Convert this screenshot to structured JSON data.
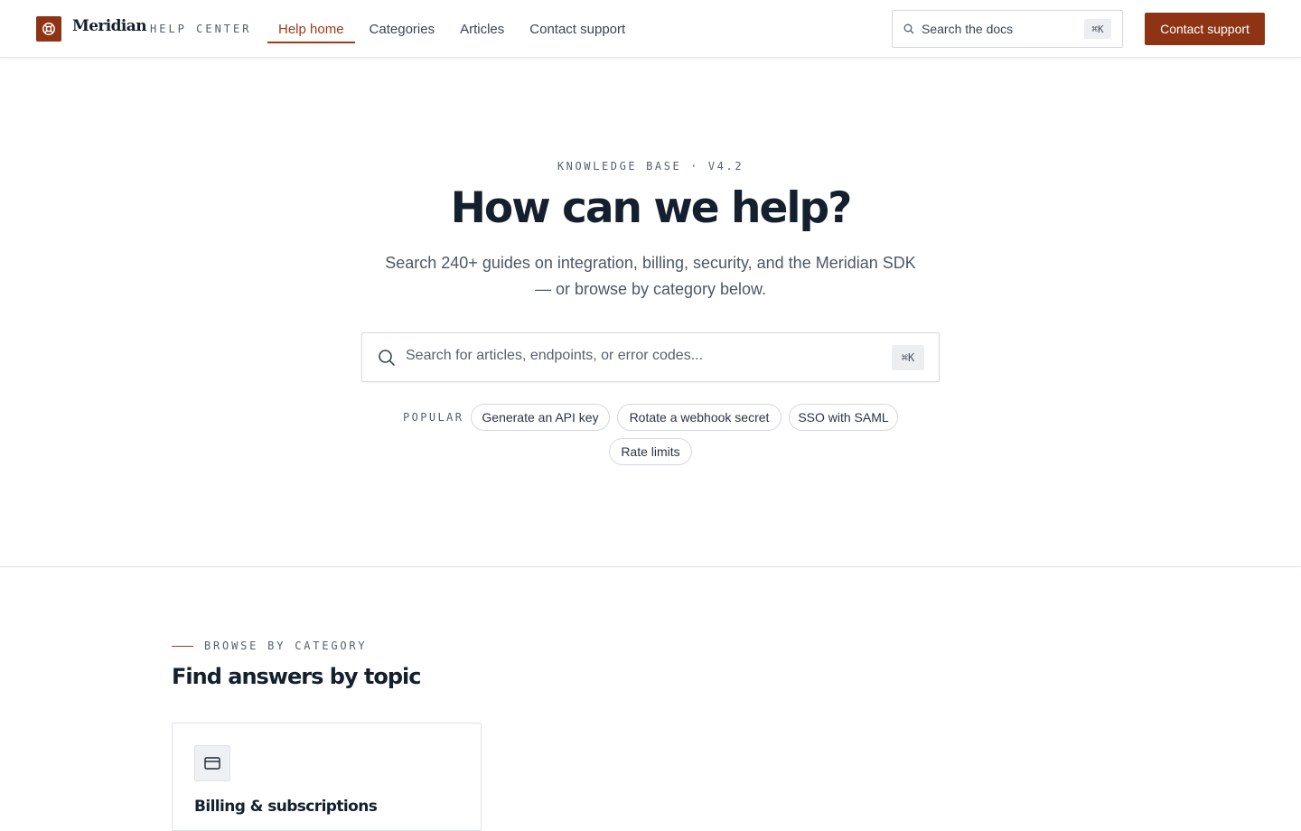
{
  "header": {
    "brand_name": "Meridian",
    "brand_tag": "HELP CENTER",
    "nav": [
      {
        "label": "Help home",
        "active": true
      },
      {
        "label": "Categories"
      },
      {
        "label": "Articles"
      },
      {
        "label": "Contact support"
      }
    ],
    "search_placeholder": "Search the docs",
    "search_shortcut": "⌘K",
    "cta_label": "Contact support"
  },
  "hero": {
    "eyebrow": "KNOWLEDGE BASE · V4.2",
    "title": "How can we help?",
    "subtitle": "Search 240+ guides on integration, billing, security, and the Meridian SDK — or browse by category below.",
    "search_placeholder": "Search for articles, endpoints, or error codes...",
    "search_shortcut": "⌘K",
    "popular_label": "POPULAR",
    "popular": [
      "Generate an API key",
      "Rotate a webhook secret",
      "SSO with SAML",
      "Rate limits"
    ]
  },
  "browse": {
    "eyebrow": "BROWSE BY CATEGORY",
    "title": "Find answers by topic",
    "categories": [
      {
        "title": "Billing & subscriptions",
        "icon": "credit-card-icon"
      }
    ]
  },
  "colors": {
    "accent": "#8e3414",
    "accent_text": "#a23a18",
    "heading": "#15202f",
    "muted": "#56606f"
  }
}
